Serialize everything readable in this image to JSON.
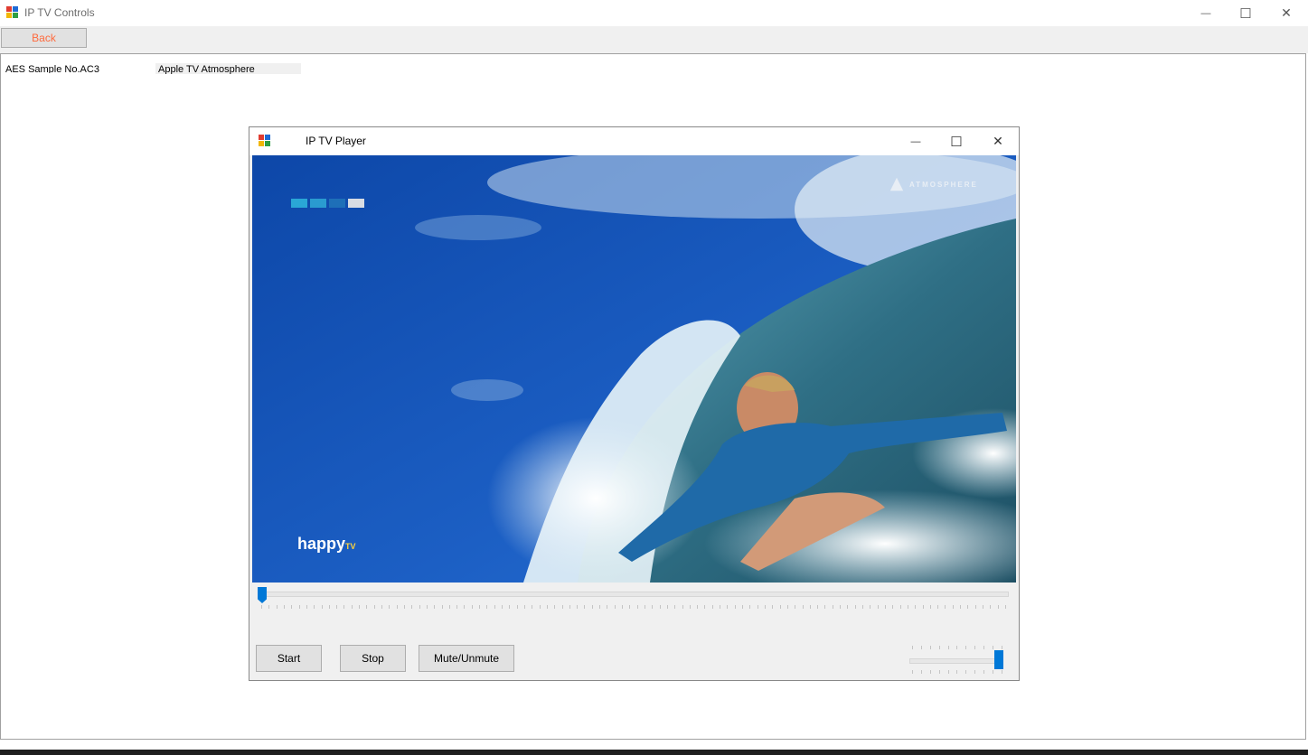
{
  "window": {
    "title": "IP TV Controls",
    "minimize_glyph": "—",
    "maximize_glyph": "☐",
    "close_glyph": "✕"
  },
  "toolbar": {
    "back_label": "Back"
  },
  "info": {
    "label": "AES Sample No.AC3",
    "value": "Apple TV Atmosphere"
  },
  "player": {
    "title": "IP TV Player",
    "minimize_glyph": "—",
    "maximize_glyph": "☐",
    "close_glyph": "✕",
    "overlay_brand": "ATMOSPHERE",
    "overlay_channel": "happy",
    "overlay_channel_suffix": "TV",
    "seek_position": 0.0,
    "volume_level": 1.0,
    "buttons": {
      "start": "Start",
      "stop": "Stop",
      "mute": "Mute/Unmute"
    }
  },
  "colors": {
    "back_text": "#ff6a3d",
    "slider_thumb": "#0078d7"
  }
}
